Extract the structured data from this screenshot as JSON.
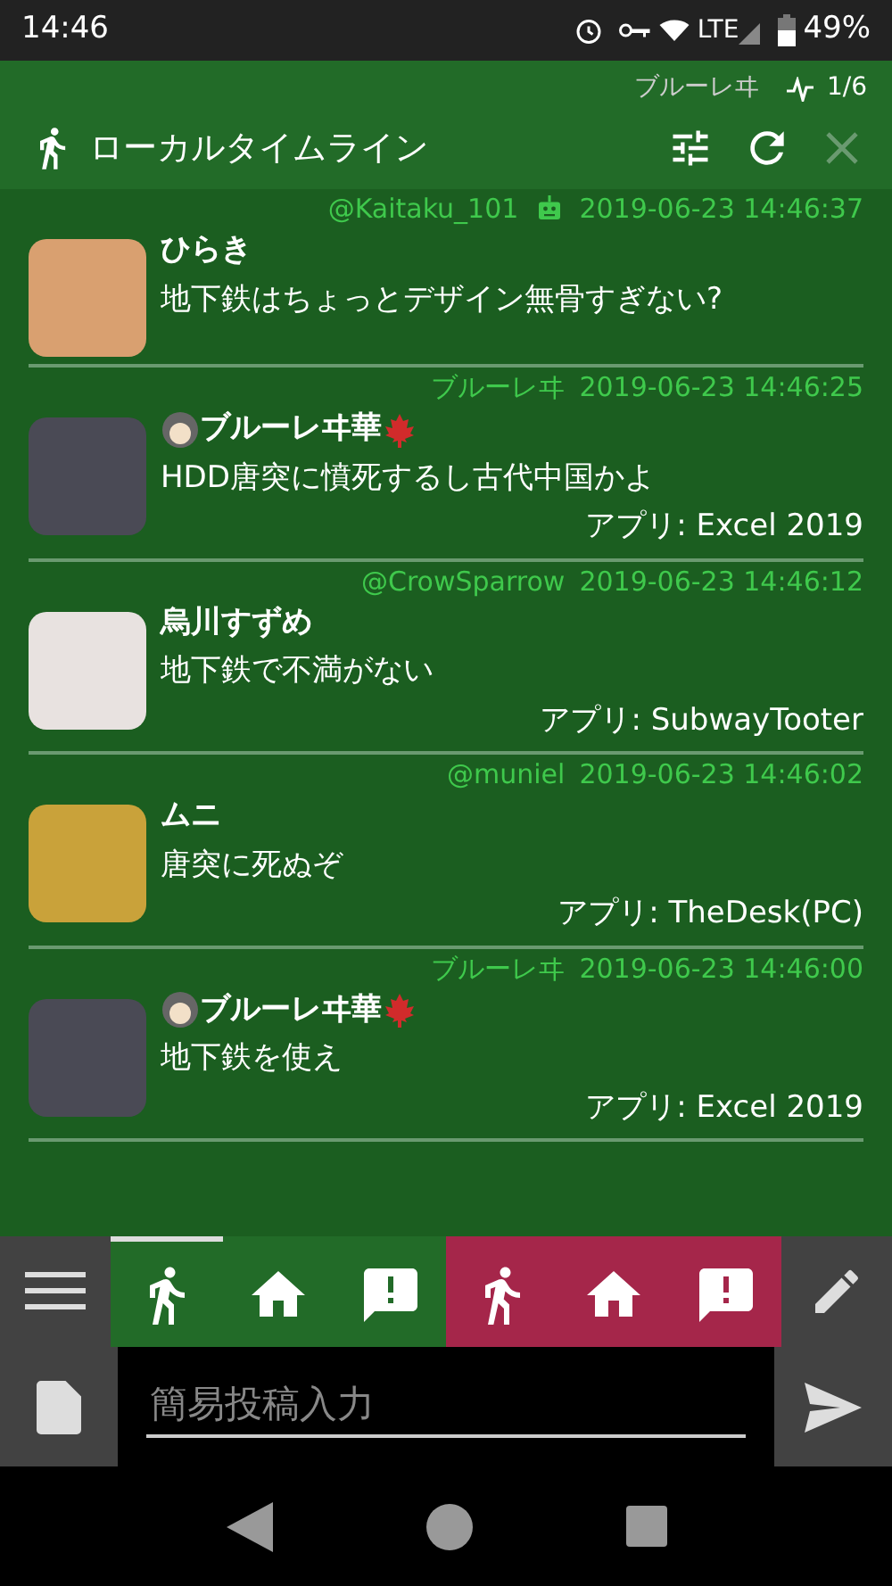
{
  "status_bar": {
    "time": "14:46",
    "network": "LTE",
    "battery": "49%"
  },
  "header": {
    "account": "ブルーレヰ",
    "position": "1/6",
    "title": "ローカルタイムライン",
    "close_disabled": true
  },
  "posts": [
    {
      "acct": "@Kaitaku_101",
      "bot": true,
      "time": "2019-06-23 14:46:37",
      "name": "ひらき",
      "emoji_before": false,
      "emoji_after": false,
      "content": "地下鉄はちょっとデザイン無骨すぎない?"
    },
    {
      "acct": "ブルーレヰ",
      "bot": false,
      "time": "2019-06-23 14:46:25",
      "name": "ブルーレヰ華",
      "emoji_before": true,
      "emoji_after": true,
      "content": "HDD唐突に憤死するし古代中国かよ",
      "app": "アプリ: Excel 2019"
    },
    {
      "acct": "@CrowSparrow",
      "bot": false,
      "time": "2019-06-23 14:46:12",
      "name": "烏川すずめ",
      "emoji_before": false,
      "emoji_after": false,
      "content": "地下鉄で不満がない",
      "app": "アプリ: SubwayTooter"
    },
    {
      "acct": "@muniel",
      "bot": false,
      "time": "2019-06-23 14:46:02",
      "name": "ムニ",
      "emoji_before": false,
      "emoji_after": false,
      "content": "唐突に死ぬぞ",
      "app": "アプリ: TheDesk(PC)"
    },
    {
      "acct": "ブルーレヰ",
      "bot": false,
      "time": "2019-06-23 14:46:00",
      "name": "ブルーレヰ華",
      "emoji_before": true,
      "emoji_after": true,
      "content": "地下鉄を使え",
      "app": "アプリ: Excel 2019"
    }
  ],
  "column_tabs": [
    {
      "kind": "local",
      "color": "#226b28",
      "selected": true
    },
    {
      "kind": "home",
      "color": "#226b28",
      "selected": false
    },
    {
      "kind": "notification",
      "color": "#226b28",
      "selected": false
    },
    {
      "kind": "local",
      "color": "#a5264a",
      "selected": false
    },
    {
      "kind": "home",
      "color": "#a5264a",
      "selected": false
    },
    {
      "kind": "notification",
      "color": "#a5264a",
      "selected": false
    }
  ],
  "composer": {
    "placeholder": "簡易投稿入力"
  }
}
